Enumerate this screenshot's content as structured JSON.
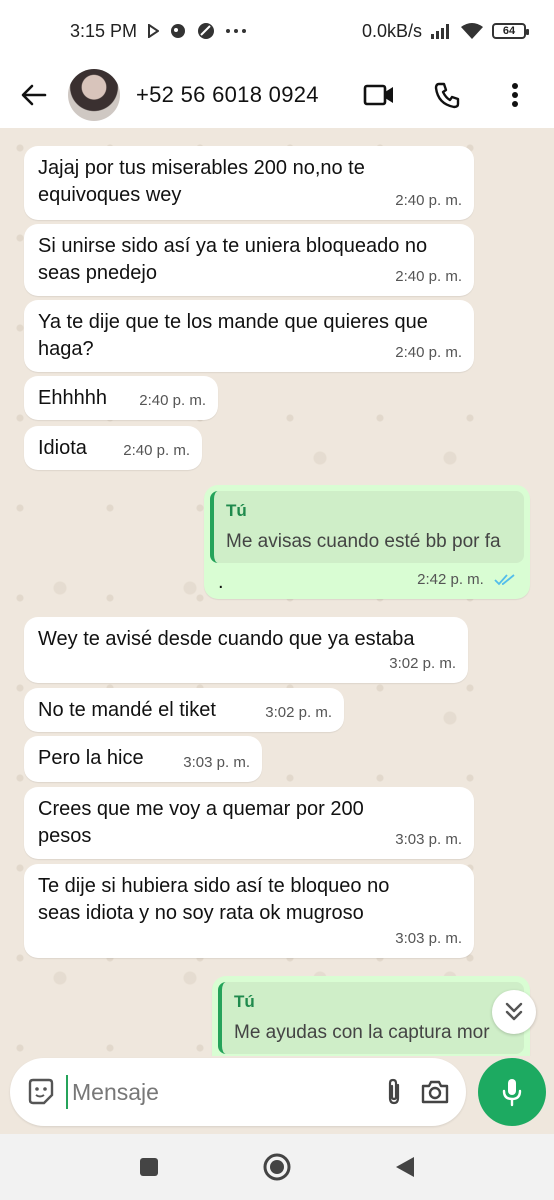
{
  "status_bar": {
    "time": "3:15 PM",
    "speed": "0.0kB/s",
    "battery": "64",
    "icons": [
      "play-icon",
      "notification-icon",
      "circle-icon",
      "more-dots-icon",
      "signal-icon",
      "wifi-icon",
      "battery-icon"
    ]
  },
  "header": {
    "contact_name": "+52 56 6018 0924",
    "icons": [
      "back-arrow-icon",
      "video-call-icon",
      "phone-icon",
      "more-vert-icon"
    ]
  },
  "messages": [
    {
      "dir": "in",
      "text": "Jajaj por tus miserables 200  no,no te equivoques wey",
      "time": "2:40 p. m."
    },
    {
      "dir": "in",
      "text": "Si unirse sido así ya te uniera bloqueado no seas pnedejo",
      "time": "2:40 p. m."
    },
    {
      "dir": "in",
      "text": "Ya te dije que te los mande que quieres que haga?",
      "time": "2:40 p. m."
    },
    {
      "dir": "in",
      "text": "Ehhhhh",
      "time": "2:40 p. m."
    },
    {
      "dir": "in",
      "text": "Idiota",
      "time": "2:40 p. m."
    },
    {
      "dir": "out",
      "quote_author": "Tú",
      "quote_text": "Me avisas cuando esté bb por fa",
      "text": ".",
      "time": "2:42 p. m."
    },
    {
      "dir": "in",
      "text": "Wey te avisé desde cuando que ya estaba",
      "time": "3:02 p. m."
    },
    {
      "dir": "in",
      "text": "No te mandé el tiket",
      "time": "3:02 p. m."
    },
    {
      "dir": "in",
      "text": "Pero la hice",
      "time": "3:03 p. m."
    },
    {
      "dir": "in",
      "text": "Crees que me voy a quemar por 200 pesos",
      "time": "3:03 p. m."
    },
    {
      "dir": "in",
      "text": "Te dije si hubiera sido así te bloqueo no seas idiota y no soy rata ok mugroso",
      "time": "3:03 p. m."
    },
    {
      "dir": "out",
      "quote_author": "Tú",
      "quote_text": "Me ayudas con la captura mor"
    }
  ],
  "input": {
    "placeholder": "Mensaje"
  },
  "colors": {
    "accent": "#1daa61",
    "outgoing_bubble": "#d9fdd3",
    "chat_background": "#efe7dd",
    "read_ticks": "#53bdeb"
  }
}
